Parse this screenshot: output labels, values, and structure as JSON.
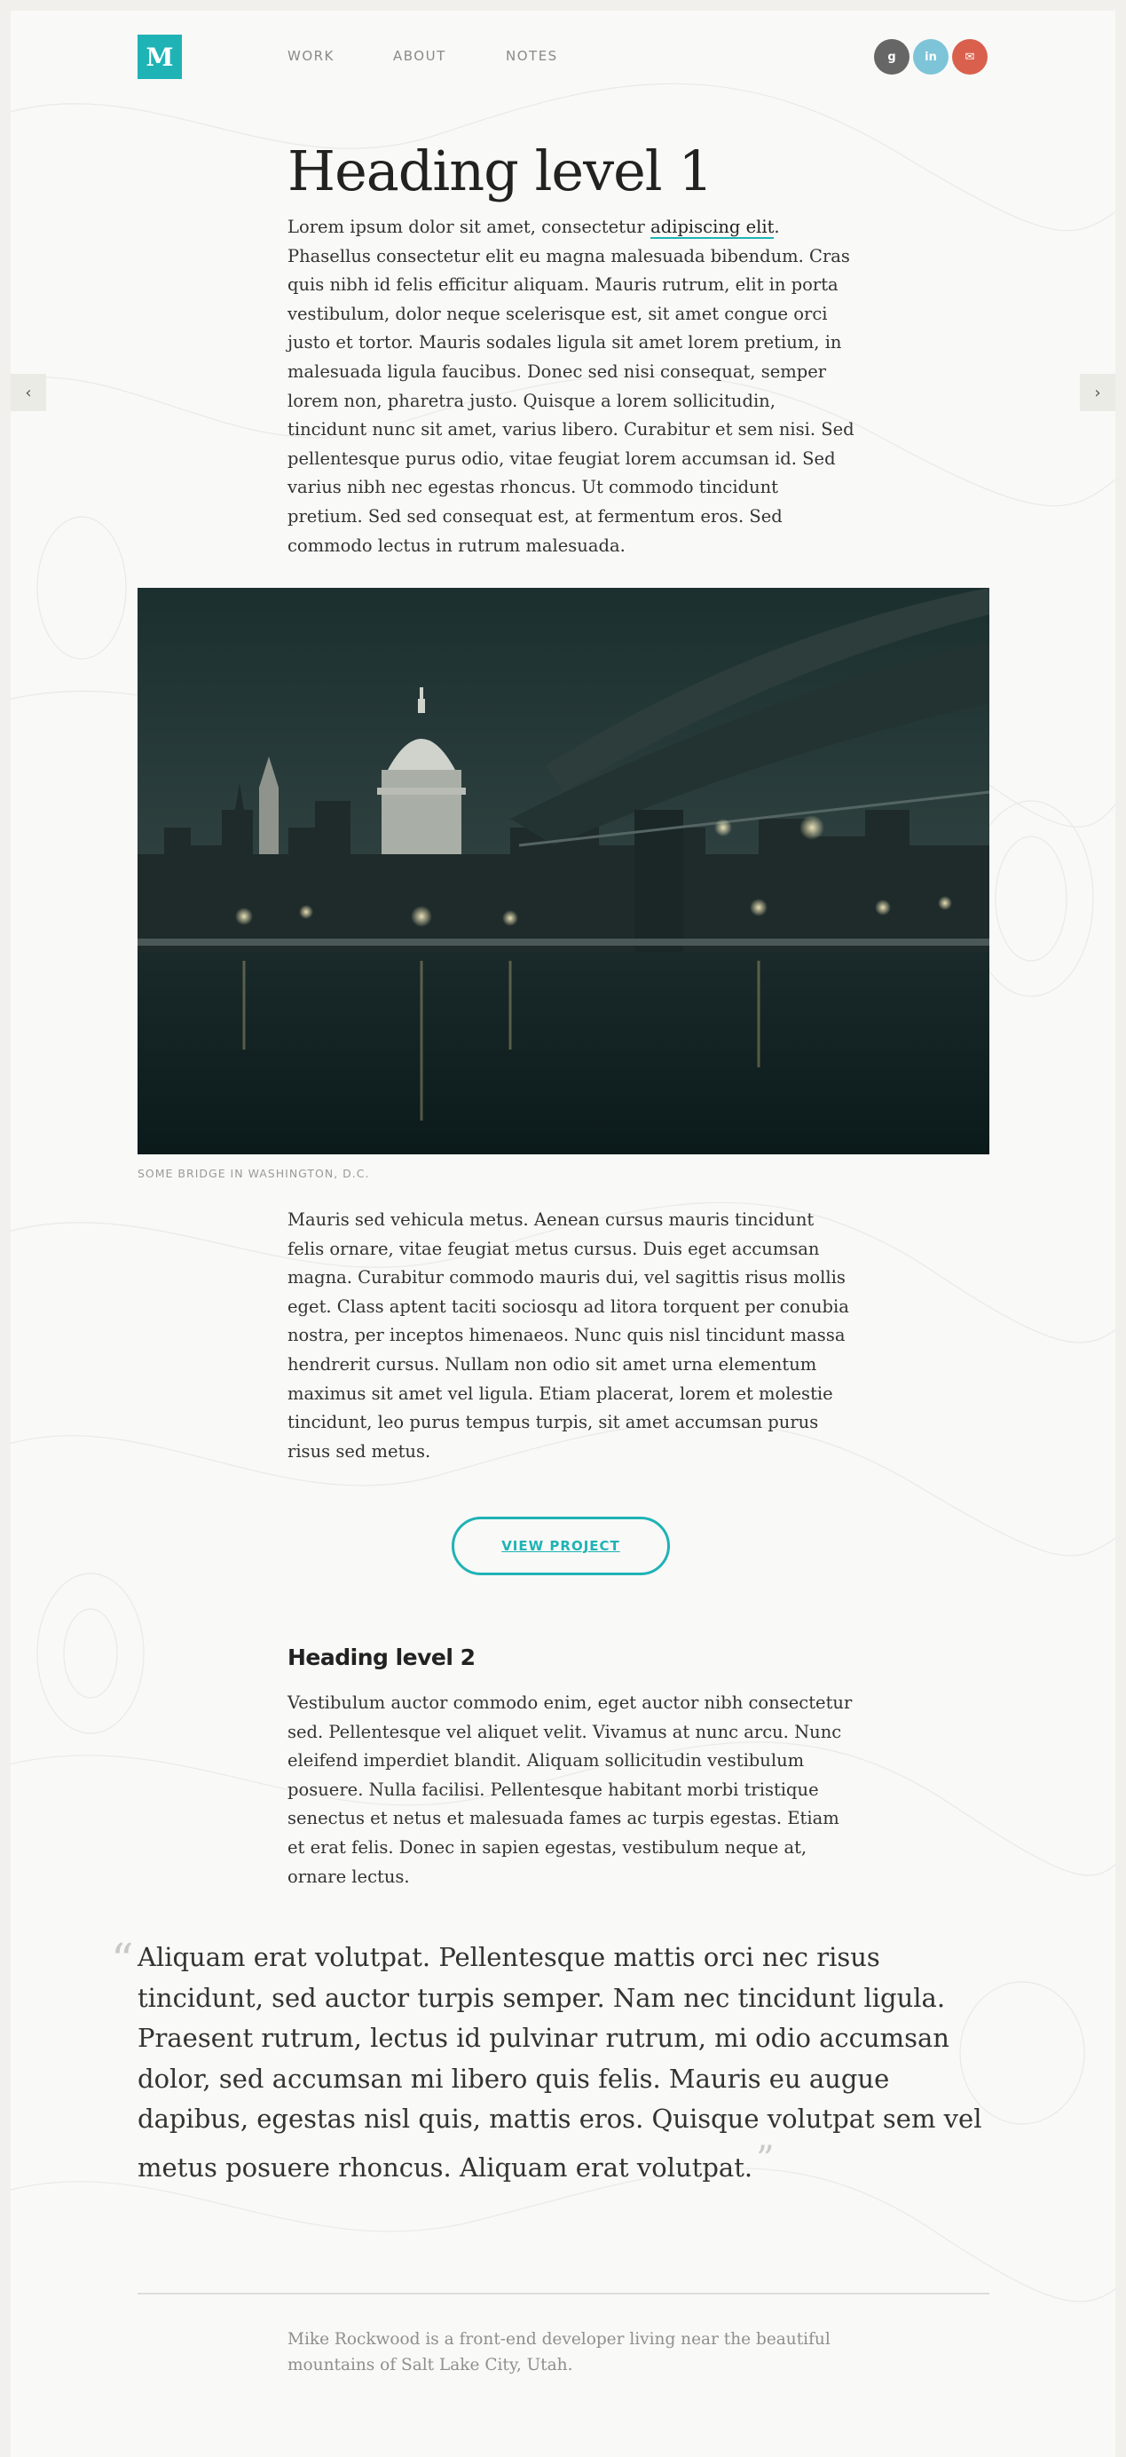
{
  "header": {
    "logo_letter": "M",
    "nav": [
      {
        "label": "WORK"
      },
      {
        "label": "ABOUT"
      },
      {
        "label": "NOTES"
      }
    ],
    "social": [
      {
        "icon": "google-plus-icon",
        "glyph": "g",
        "color": "#666666"
      },
      {
        "icon": "linkedin-icon",
        "glyph": "in",
        "color": "#7ec4d8"
      },
      {
        "icon": "email-icon",
        "glyph": "✉",
        "color": "#d9604c"
      }
    ],
    "accent_color": "#1fb3b5"
  },
  "nav_arrows": {
    "prev": "‹",
    "next": "›"
  },
  "article": {
    "h1": "Heading level 1",
    "intro_before_link": "Lorem ipsum dolor sit amet, consectetur ",
    "intro_link": "adipiscing elit",
    "intro_after_link": ". Phasellus consectetur elit eu magna malesuada bibendum. Cras quis nibh id felis efficitur aliquam. Mauris rutrum, elit in porta vestibulum, dolor neque scelerisque est, sit amet congue orci justo et tortor. Mauris sodales ligula sit amet lorem pretium, in malesuada ligula faucibus. Donec sed nisi consequat, semper lorem non, pharetra justo. Quisque a lorem sollicitudin, tincidunt nunc sit amet, varius libero. Curabitur et sem nisi. Sed pellentesque purus odio, vitae feugiat lorem accumsan id. Sed varius nibh nec egestas rhoncus. Ut commodo tincidunt pretium. Sed sed consequat est, at fermentum eros. Sed commodo lectus in rutrum malesuada.",
    "image_caption": "SOME BRIDGE IN WASHINGTON, D.C.",
    "paragraph2": "Mauris sed vehicula metus. Aenean cursus mauris tincidunt felis ornare, vitae feugiat metus cursus. Duis eget accumsan magna. Curabitur commodo mauris dui, vel sagittis risus mollis eget. Class aptent taciti sociosqu ad litora torquent per conubia nostra, per inceptos himenaeos. Nunc quis nisl tincidunt massa hendrerit cursus. Nullam non odio sit amet urna elementum maximus sit amet vel ligula. Etiam placerat, lorem et molestie tincidunt, leo purus tempus turpis, sit amet accumsan purus risus sed metus.",
    "button_label": "VIEW PROJECT",
    "h2": "Heading level 2",
    "paragraph3": "Vestibulum auctor commodo enim, eget auctor nibh consectetur sed. Pellentesque vel aliquet velit. Vivamus at nunc arcu. Nunc eleifend imperdiet blandit. Aliquam sollicitudin vestibulum posuere. Nulla facilisi. Pellentesque habitant morbi tristique senectus et netus et malesuada fames ac turpis egestas. Etiam et erat felis. Donec in sapien egestas, vestibulum neque at, ornare lectus.",
    "quote_open": "“",
    "quote": "Aliquam erat volutpat. Pellentesque mattis orci nec risus tincidunt, sed auctor turpis semper. Nam nec tincidunt ligula. Praesent rutrum, lectus id pulvinar rutrum, mi odio accumsan dolor, sed accumsan mi libero quis felis. Mauris eu augue dapibus, egestas nisl quis, mattis eros. Quisque volutpat sem vel metus posuere rhoncus. Aliquam erat volutpat.",
    "quote_close": "”"
  },
  "footer": {
    "bio": "Mike Rockwood is a front-end developer living near the beautiful mountains of Salt Lake City, Utah."
  }
}
